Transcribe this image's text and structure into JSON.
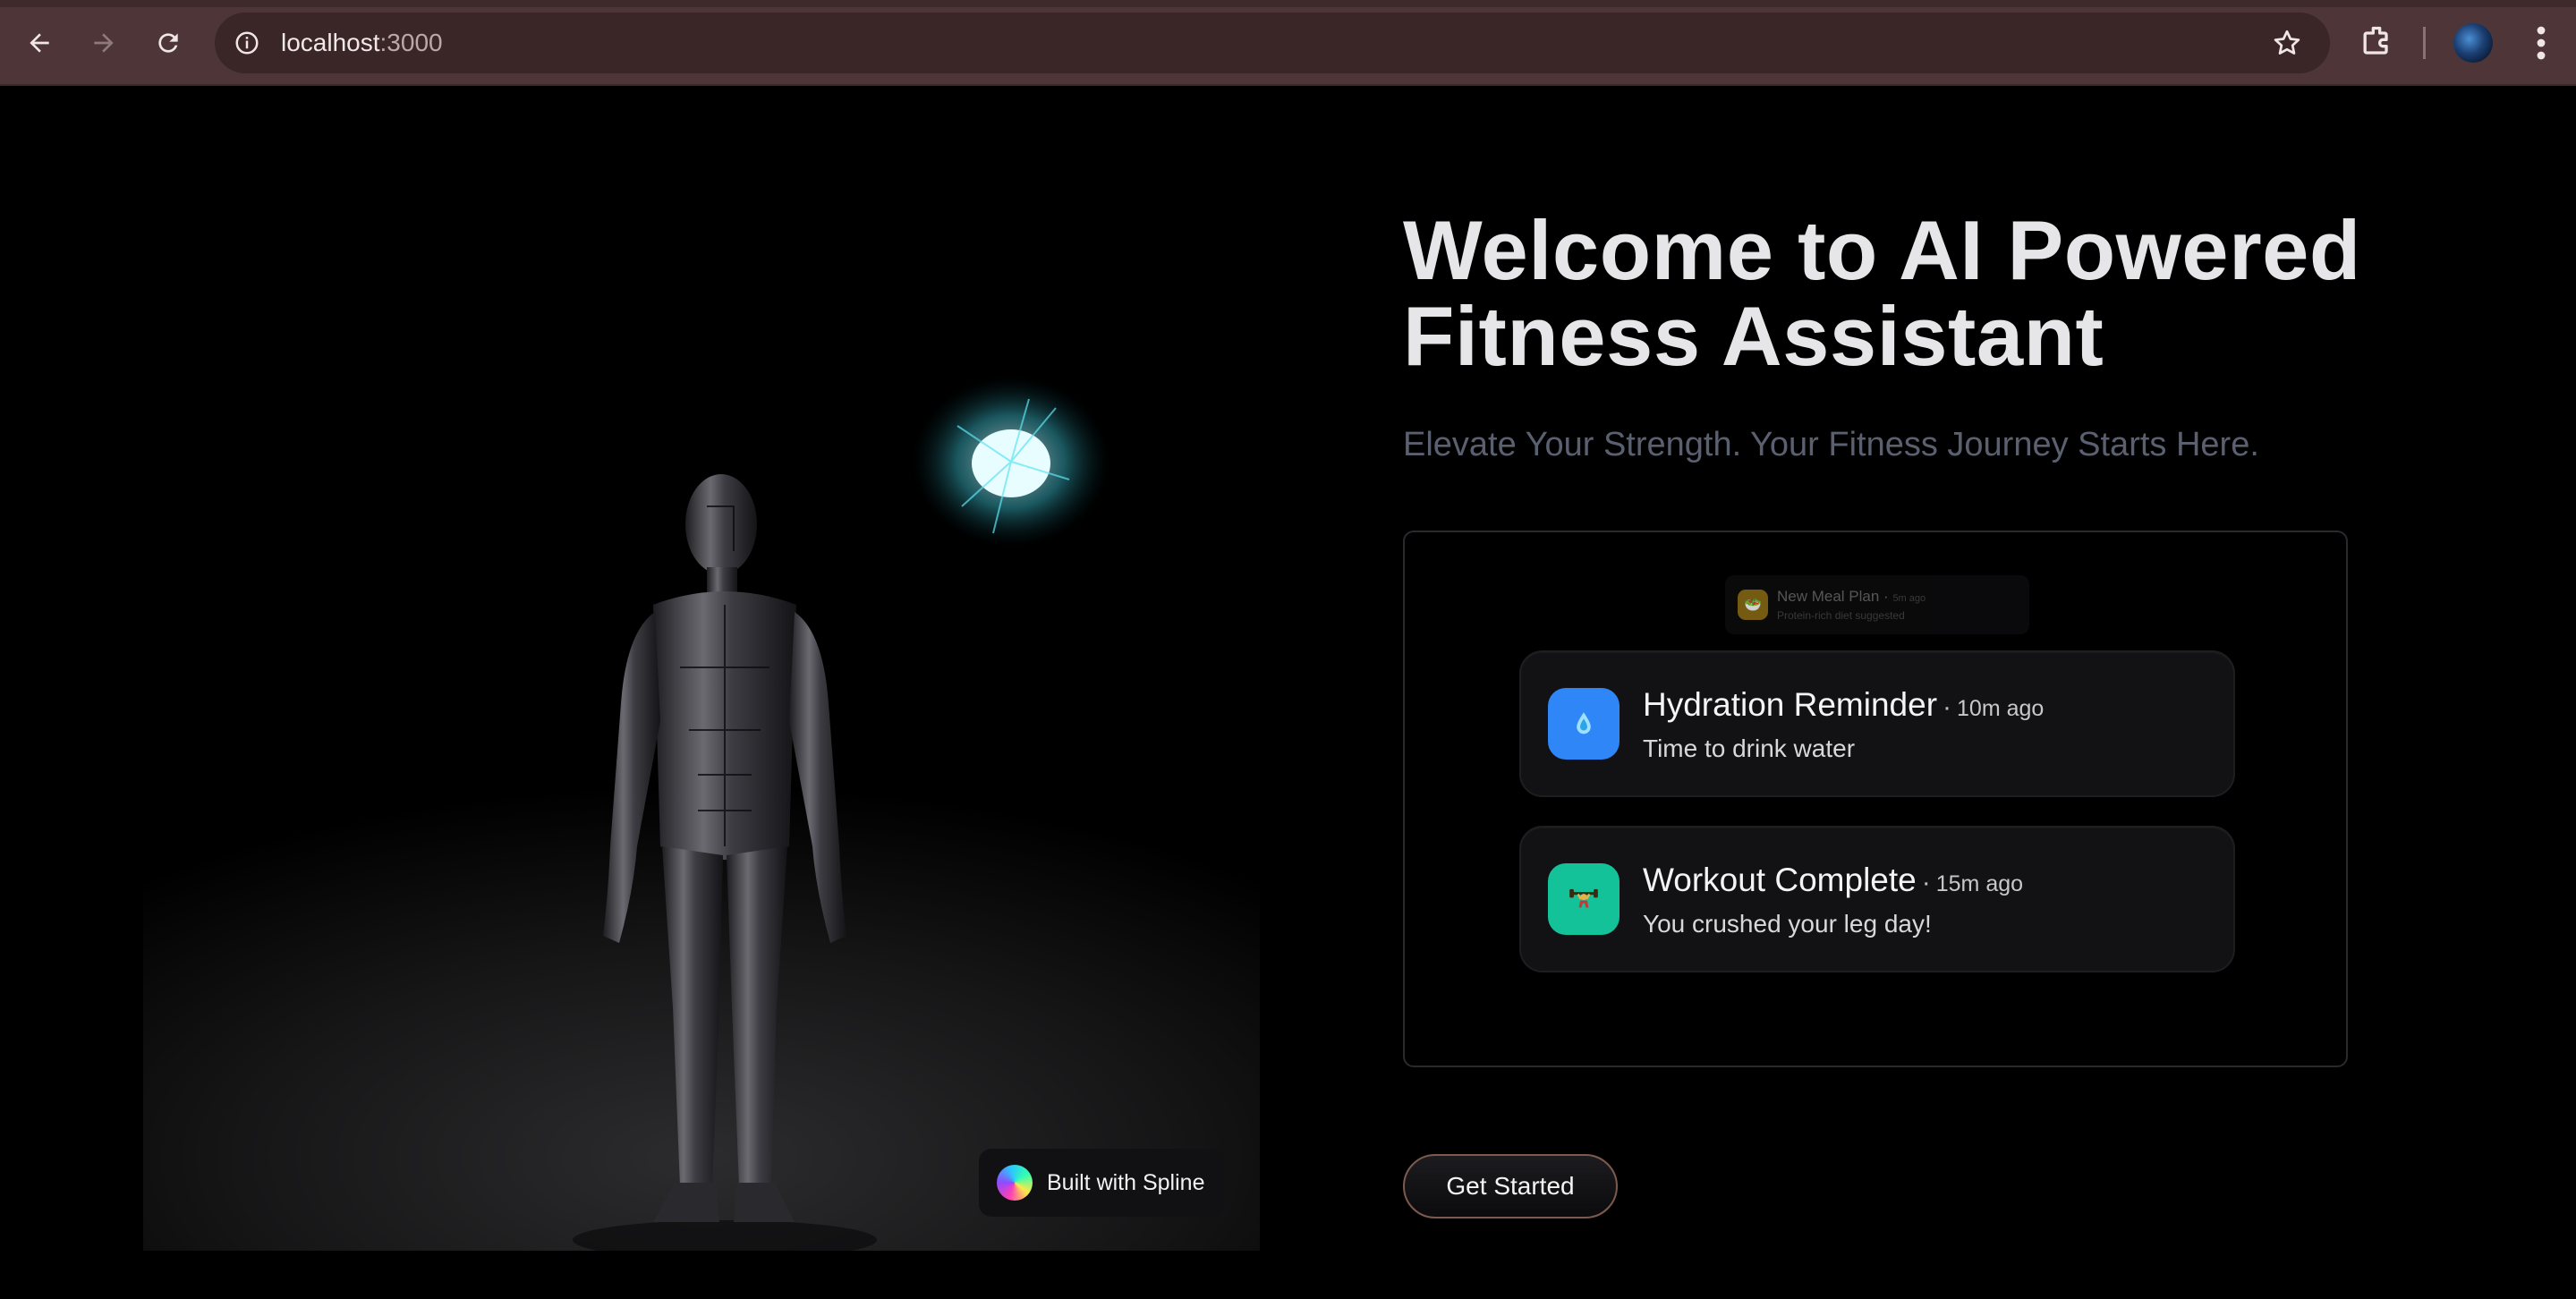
{
  "browser": {
    "url_host": "localhost",
    "url_port": ":3000"
  },
  "scene": {
    "badge_label": "Built with Spline"
  },
  "hero": {
    "title_line1": "Welcome to AI Powered",
    "title_line2": "Fitness Assistant",
    "subtitle": "Elevate Your Strength. Your Fitness Journey Starts Here."
  },
  "notifications": {
    "ghost": {
      "title": "New Meal Plan",
      "time": "5m ago",
      "description": "Protein-rich diet suggested",
      "icon": "meal-icon",
      "color": "#8a6a14"
    },
    "items": [
      {
        "title": "Hydration Reminder",
        "time": "10m ago",
        "description": "Time to drink water",
        "icon": "water-drop-icon",
        "color": "#2f86f6"
      },
      {
        "title": "Workout Complete",
        "time": "15m ago",
        "description": "You crushed your leg day!",
        "icon": "weightlifter-icon",
        "color": "#14c29a"
      }
    ]
  },
  "cta": {
    "label": "Get Started"
  },
  "colors": {
    "chrome": "#4e3638",
    "accent_border": "#7d5a4e"
  }
}
